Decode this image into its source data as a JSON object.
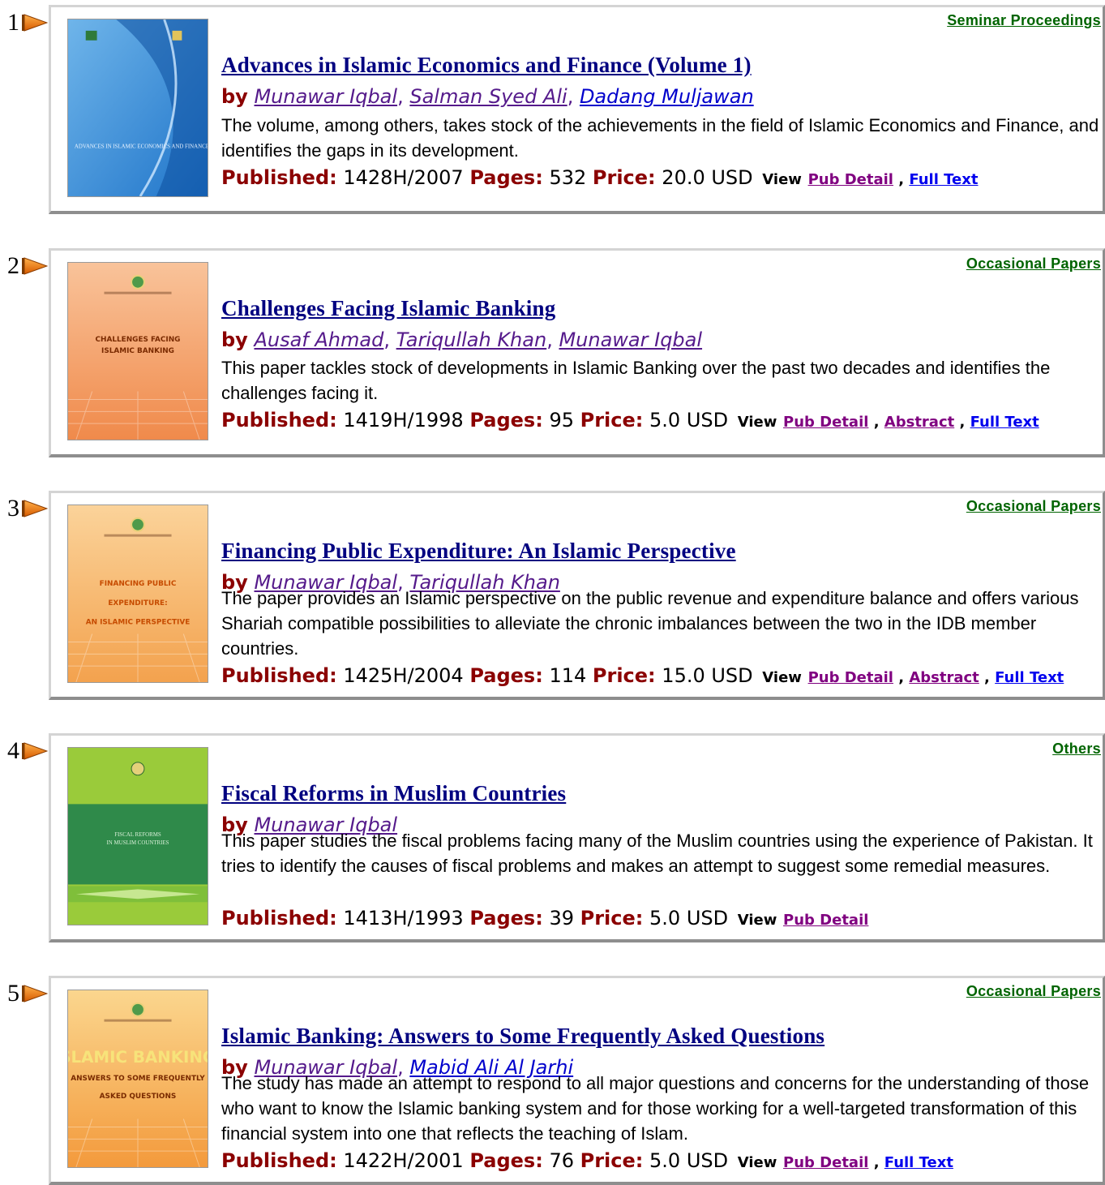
{
  "results": [
    {
      "number": "1",
      "category": "Seminar Proceedings",
      "title": "Advances in Islamic Economics and Finance (Volume 1)",
      "by": "by",
      "authors": [
        "Munawar Iqbal",
        "Salman Syed Ali",
        "Dadang Muljawan"
      ],
      "description": "The volume, among others, takes stock of the achievements in the field of Islamic Economics and Finance, and identifies the gaps in its development.",
      "published_label": "Published:",
      "published": "1428H/2007",
      "pages_label": "Pages:",
      "pages": "532",
      "price_label": "Price:",
      "price": "20.0 USD",
      "view_label": "View",
      "links": [
        "Pub Detail",
        "Full Text"
      ],
      "cover_text": "ADVANCES IN ISLAMIC ECONOMICS AND FINANCE",
      "cover_colors": [
        "#1f74c9",
        "#6fb5ea"
      ]
    },
    {
      "number": "2",
      "category": "Occasional Papers",
      "title": "Challenges Facing Islamic Banking",
      "by": "by",
      "authors": [
        "Ausaf Ahmad",
        "Tariqullah Khan",
        "Munawar Iqbal"
      ],
      "description": "This paper tackles stock of developments in Islamic Banking over the past two decades and identifies the challenges facing it.",
      "published_label": "Published:",
      "published": "1419H/1998",
      "pages_label": "Pages:",
      "pages": "95",
      "price_label": "Price:",
      "price": "5.0 USD",
      "view_label": "View",
      "links": [
        "Pub Detail",
        "Abstract",
        "Full Text"
      ],
      "cover_text": "CHALLENGES FACING ISLAMIC BANKING",
      "cover_colors": [
        "#f08a4b",
        "#f9c39a"
      ]
    },
    {
      "number": "3",
      "category": "Occasional Papers",
      "title": "Financing Public Expenditure: An Islamic Perspective",
      "by": "by",
      "authors": [
        "Munawar Iqbal",
        "Tariqullah Khan"
      ],
      "description": "The paper provides an Islamic perspective on the public revenue and expenditure balance and offers various Shariah compatible possibilities to alleviate the chronic imbalances between the two in the IDB member countries.",
      "published_label": "Published:",
      "published": "1425H/2004",
      "pages_label": "Pages:",
      "pages": "114",
      "price_label": "Price:",
      "price": "15.0 USD",
      "view_label": "View",
      "links": [
        "Pub Detail",
        "Abstract",
        "Full Text"
      ],
      "cover_text": "FINANCING PUBLIC EXPENDITURE: AN ISLAMIC PERSPECTIVE",
      "cover_colors": [
        "#f3a24e",
        "#fbd39a"
      ]
    },
    {
      "number": "4",
      "category": "Others",
      "title": "Fiscal Reforms in Muslim Countries",
      "by": "by",
      "authors": [
        "Munawar Iqbal"
      ],
      "description": "This paper studies the fiscal problems facing many of the Muslim countries using the experience of Pakistan. It tries to identify the causes of fiscal problems and makes an attempt to suggest some remedial measures.",
      "published_label": "Published:",
      "published": "1413H/1993",
      "pages_label": "Pages:",
      "pages": "39",
      "price_label": "Price:",
      "price": "5.0 USD",
      "view_label": "View",
      "links": [
        "Pub Detail"
      ],
      "cover_text": "FISCAL REFORMS IN MUSLIM COUNTRIES",
      "cover_colors": [
        "#9acb3a",
        "#2f8a4a"
      ]
    },
    {
      "number": "5",
      "category": "Occasional Papers",
      "title": "Islamic Banking: Answers to Some Frequently Asked Questions",
      "by": "by",
      "authors": [
        "Munawar Iqbal",
        "Mabid Ali Al Jarhi"
      ],
      "description": "The study has made an attempt to respond to all major questions and concerns for the understanding of those who want to know the Islamic banking system and for those working for a well-targeted transformation of this financial system into one that reflects the teaching of Islam.",
      "published_label": "Published:",
      "published": "1422H/2001",
      "pages_label": "Pages:",
      "pages": "76",
      "price_label": "Price:",
      "price": "5.0 USD",
      "view_label": "View",
      "links": [
        "Pub Detail",
        "Full Text"
      ],
      "cover_text": "ISLAMIC BANKING: ANSWERS TO SOME FREQUENTLY ASKED QUESTIONS",
      "cover_colors": [
        "#f39a3c",
        "#fbd68e"
      ]
    }
  ]
}
